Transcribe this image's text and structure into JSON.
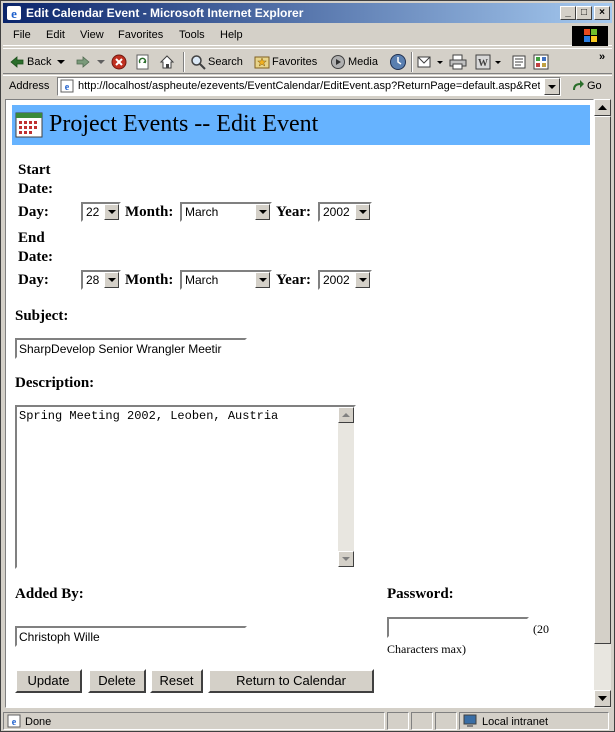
{
  "window": {
    "title": "Edit Calendar Event - Microsoft Internet Explorer",
    "min_glyph": "_",
    "max_glyph": "□",
    "close_glyph": "×"
  },
  "menu": {
    "file": "File",
    "edit": "Edit",
    "view": "View",
    "favorites": "Favorites",
    "tools": "Tools",
    "help": "Help"
  },
  "toolbar": {
    "back": "Back",
    "search": "Search",
    "favorites": "Favorites",
    "media": "Media",
    "chevron": "»"
  },
  "address": {
    "label": "Address",
    "url": "http://localhost/aspheute/ezevents/EventCalendar/EditEvent.asp?ReturnPage=default.asp&Ret",
    "go": "Go"
  },
  "page": {
    "heading": "Project Events -- Edit Event",
    "start": {
      "label_line1": "Start",
      "label_line2": "Date:",
      "day_label": "Day:",
      "day": "22",
      "month_label": "Month:",
      "month": "March",
      "year_label": "Year:",
      "year": "2002"
    },
    "end": {
      "label_line1": "End",
      "label_line2": "Date:",
      "day_label": "Day:",
      "day": "28",
      "month_label": "Month:",
      "month": "March",
      "year_label": "Year:",
      "year": "2002"
    },
    "subject_label": "Subject:",
    "subject_value": "SharpDevelop Senior Wrangler Meetir",
    "description_label": "Description:",
    "description_value": "Spring Meeting 2002, Leoben, Austria",
    "added_by_label": "Added By:",
    "added_by_value": "Christoph Wille",
    "password_label": "Password:",
    "password_value": "",
    "password_hint_1": "(20",
    "password_hint_2": "Characters max)",
    "buttons": {
      "update": "Update",
      "delete": "Delete",
      "reset": "Reset",
      "return": "Return to Calendar"
    }
  },
  "status": {
    "text": "Done",
    "zone": "Local intranet"
  },
  "colors": {
    "header_bg": "#66b3ff",
    "titlebar_start": "#0a246a",
    "titlebar_end": "#a6caf0",
    "chrome": "#d4d0c8"
  }
}
